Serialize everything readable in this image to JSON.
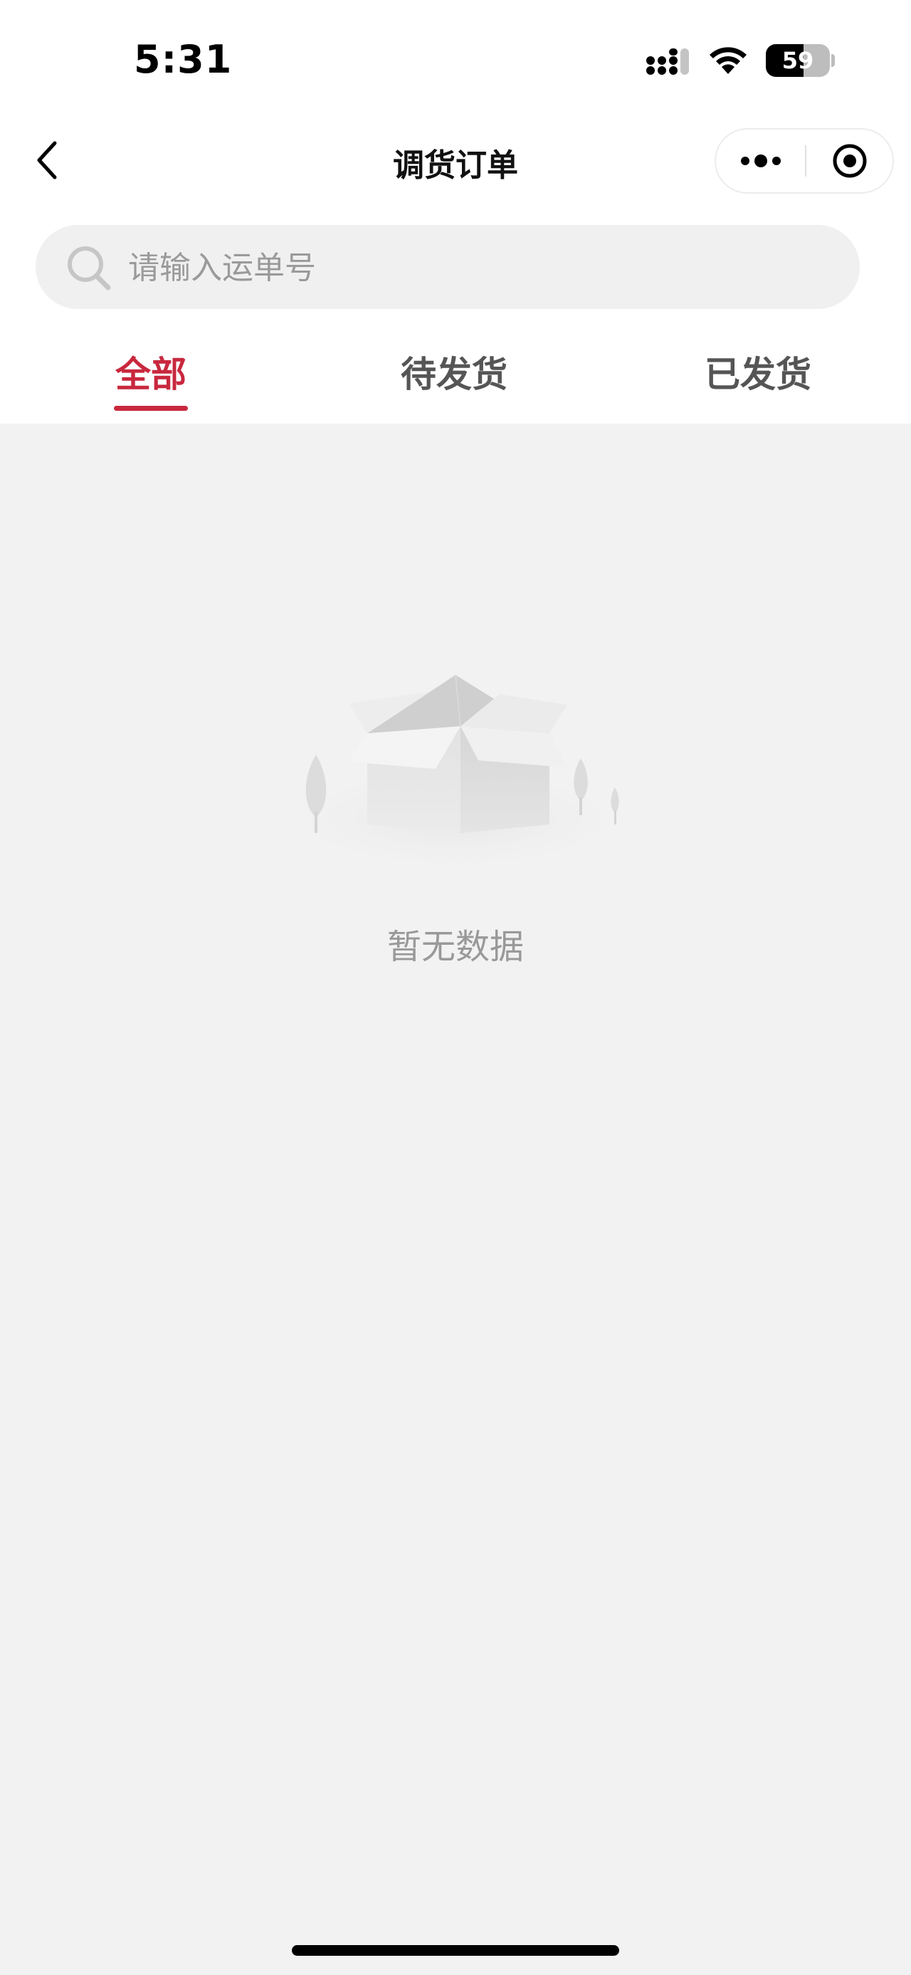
{
  "status_bar": {
    "time": "5:31",
    "battery_level": "59",
    "icons": [
      "cellular-signal-icon",
      "wifi-icon",
      "battery-icon"
    ]
  },
  "nav": {
    "title": "调货订单",
    "back_icon": "chevron-left-icon",
    "more_icon": "more-dots-icon",
    "close_icon": "target-circle-icon"
  },
  "search": {
    "placeholder": "请输入运单号",
    "value": "",
    "icon": "search-icon"
  },
  "tabs": [
    {
      "label": "全部",
      "active": true
    },
    {
      "label": "待发货",
      "active": false
    },
    {
      "label": "已发货",
      "active": false
    }
  ],
  "empty": {
    "text": "暂无数据",
    "icon": "empty-box-icon"
  },
  "colors": {
    "accent": "#c8283e",
    "background": "#f2f2f2",
    "header_background": "#ffffff"
  }
}
